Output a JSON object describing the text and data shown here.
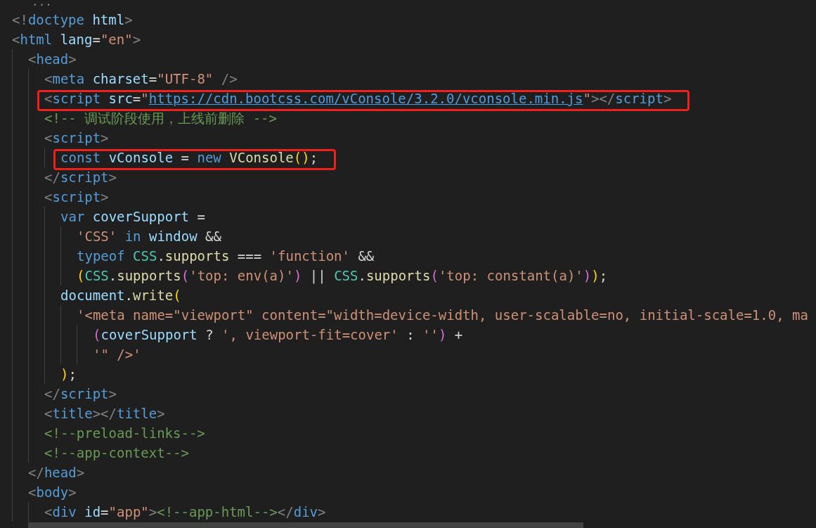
{
  "editor": {
    "fold_marker": "...",
    "lines": [
      {
        "highlighted": false,
        "tokens": [
          {
            "kind": "punct",
            "text": "<!"
          },
          {
            "kind": "tag",
            "text": "doctype"
          },
          {
            "kind": "attr",
            "text": " html"
          },
          {
            "kind": "punct",
            "text": ">"
          }
        ]
      },
      {
        "highlighted": false,
        "tokens": [
          {
            "kind": "punct",
            "text": "<"
          },
          {
            "kind": "tag",
            "text": "html"
          },
          {
            "kind": "attr",
            "text": " lang"
          },
          {
            "kind": "plain",
            "text": "="
          },
          {
            "kind": "string",
            "text": "\"en\""
          },
          {
            "kind": "punct",
            "text": ">"
          }
        ],
        "children": [
          {
            "highlighted": false,
            "tokens": [
              {
                "kind": "punct",
                "text": "<"
              },
              {
                "kind": "tag",
                "text": "head"
              },
              {
                "kind": "punct",
                "text": ">"
              }
            ],
            "children": [
              {
                "highlighted": false,
                "tokens": [
                  {
                    "kind": "punct",
                    "text": "<"
                  },
                  {
                    "kind": "tag",
                    "text": "meta"
                  },
                  {
                    "kind": "attr",
                    "text": " charset"
                  },
                  {
                    "kind": "plain",
                    "text": "="
                  },
                  {
                    "kind": "string",
                    "text": "\"UTF-8\""
                  },
                  {
                    "kind": "punct",
                    "text": " />"
                  }
                ]
              },
              {
                "highlighted": true,
                "tokens": [
                  {
                    "kind": "punct",
                    "text": "<"
                  },
                  {
                    "kind": "tag",
                    "text": "script"
                  },
                  {
                    "kind": "attr",
                    "text": " src"
                  },
                  {
                    "kind": "plain",
                    "text": "="
                  },
                  {
                    "kind": "string",
                    "text": "\""
                  },
                  {
                    "kind": "link",
                    "text": "https://cdn.bootcss.com/vConsole/3.2.0/vconsole.min.js"
                  },
                  {
                    "kind": "string",
                    "text": "\""
                  },
                  {
                    "kind": "punct",
                    "text": "></"
                  },
                  {
                    "kind": "tag",
                    "text": "script"
                  },
                  {
                    "kind": "punct",
                    "text": ">"
                  }
                ]
              },
              {
                "highlighted": false,
                "tokens": [
                  {
                    "kind": "comment",
                    "text": "<!-- 调试阶段使用，上线前删除 -->"
                  }
                ]
              },
              {
                "highlighted": false,
                "tokens": [
                  {
                    "kind": "punct",
                    "text": "<"
                  },
                  {
                    "kind": "tag",
                    "text": "script"
                  },
                  {
                    "kind": "punct",
                    "text": ">"
                  }
                ],
                "children": [
                  {
                    "highlighted": true,
                    "tokens": [
                      {
                        "kind": "keyword",
                        "text": "const"
                      },
                      {
                        "kind": "variable",
                        "text": " vConsole"
                      },
                      {
                        "kind": "plain",
                        "text": " = "
                      },
                      {
                        "kind": "keyword",
                        "text": "new"
                      },
                      {
                        "kind": "function",
                        "text": " VConsole"
                      },
                      {
                        "kind": "bracket1",
                        "text": "()"
                      },
                      {
                        "kind": "plain",
                        "text": ";"
                      }
                    ]
                  }
                ]
              },
              {
                "highlighted": false,
                "tokens": [
                  {
                    "kind": "punct",
                    "text": "</"
                  },
                  {
                    "kind": "tag",
                    "text": "script"
                  },
                  {
                    "kind": "punct",
                    "text": ">"
                  }
                ]
              },
              {
                "highlighted": false,
                "tokens": [
                  {
                    "kind": "punct",
                    "text": "<"
                  },
                  {
                    "kind": "tag",
                    "text": "script"
                  },
                  {
                    "kind": "punct",
                    "text": ">"
                  }
                ],
                "children": [
                  {
                    "highlighted": false,
                    "tokens": [
                      {
                        "kind": "keyword",
                        "text": "var"
                      },
                      {
                        "kind": "variable",
                        "text": " coverSupport"
                      },
                      {
                        "kind": "plain",
                        "text": " ="
                      }
                    ],
                    "children": [
                      {
                        "highlighted": false,
                        "tokens": [
                          {
                            "kind": "string",
                            "text": "'CSS'"
                          },
                          {
                            "kind": "keyword",
                            "text": " in"
                          },
                          {
                            "kind": "variable",
                            "text": " window"
                          },
                          {
                            "kind": "plain",
                            "text": " &&"
                          }
                        ]
                      },
                      {
                        "highlighted": false,
                        "tokens": [
                          {
                            "kind": "keyword",
                            "text": "typeof"
                          },
                          {
                            "kind": "class",
                            "text": " CSS"
                          },
                          {
                            "kind": "plain",
                            "text": "."
                          },
                          {
                            "kind": "function",
                            "text": "supports"
                          },
                          {
                            "kind": "plain",
                            "text": " === "
                          },
                          {
                            "kind": "string",
                            "text": "'function'"
                          },
                          {
                            "kind": "plain",
                            "text": " &&"
                          }
                        ]
                      },
                      {
                        "highlighted": false,
                        "tokens": [
                          {
                            "kind": "bracket1",
                            "text": "("
                          },
                          {
                            "kind": "class",
                            "text": "CSS"
                          },
                          {
                            "kind": "plain",
                            "text": "."
                          },
                          {
                            "kind": "function",
                            "text": "supports"
                          },
                          {
                            "kind": "bracket2",
                            "text": "("
                          },
                          {
                            "kind": "string",
                            "text": "'top: env(a)'"
                          },
                          {
                            "kind": "bracket2",
                            "text": ")"
                          },
                          {
                            "kind": "plain",
                            "text": " || "
                          },
                          {
                            "kind": "class",
                            "text": "CSS"
                          },
                          {
                            "kind": "plain",
                            "text": "."
                          },
                          {
                            "kind": "function",
                            "text": "supports"
                          },
                          {
                            "kind": "bracket2",
                            "text": "("
                          },
                          {
                            "kind": "string",
                            "text": "'top: constant(a)'"
                          },
                          {
                            "kind": "bracket2",
                            "text": ")"
                          },
                          {
                            "kind": "bracket1",
                            "text": ")"
                          },
                          {
                            "kind": "plain",
                            "text": ";"
                          }
                        ]
                      }
                    ]
                  },
                  {
                    "highlighted": false,
                    "tokens": [
                      {
                        "kind": "variable",
                        "text": "document"
                      },
                      {
                        "kind": "function",
                        "text": ".write"
                      },
                      {
                        "kind": "bracket1",
                        "text": "("
                      }
                    ],
                    "children": [
                      {
                        "highlighted": false,
                        "tokens": [
                          {
                            "kind": "string",
                            "text": "'<meta name=\"viewport\" content=\"width=device-width, user-scalable=no, initial-scale=1.0, ma"
                          }
                        ],
                        "children": [
                          {
                            "highlighted": false,
                            "tokens": [
                              {
                                "kind": "bracket2",
                                "text": "("
                              },
                              {
                                "kind": "variable",
                                "text": "coverSupport"
                              },
                              {
                                "kind": "plain",
                                "text": " ? "
                              },
                              {
                                "kind": "string",
                                "text": "', viewport-fit=cover'"
                              },
                              {
                                "kind": "plain",
                                "text": " : "
                              },
                              {
                                "kind": "string",
                                "text": "''"
                              },
                              {
                                "kind": "bracket2",
                                "text": ")"
                              },
                              {
                                "kind": "plain",
                                "text": " +"
                              }
                            ]
                          },
                          {
                            "highlighted": false,
                            "tokens": [
                              {
                                "kind": "string",
                                "text": "'\" />'"
                              }
                            ]
                          }
                        ]
                      }
                    ]
                  },
                  {
                    "highlighted": false,
                    "tokens": [
                      {
                        "kind": "bracket1",
                        "text": ")"
                      },
                      {
                        "kind": "plain",
                        "text": ";"
                      }
                    ]
                  }
                ]
              },
              {
                "highlighted": false,
                "tokens": [
                  {
                    "kind": "punct",
                    "text": "</"
                  },
                  {
                    "kind": "tag",
                    "text": "script"
                  },
                  {
                    "kind": "punct",
                    "text": ">"
                  }
                ]
              },
              {
                "highlighted": false,
                "tokens": [
                  {
                    "kind": "punct",
                    "text": "<"
                  },
                  {
                    "kind": "tag",
                    "text": "title"
                  },
                  {
                    "kind": "punct",
                    "text": "></"
                  },
                  {
                    "kind": "tag",
                    "text": "title"
                  },
                  {
                    "kind": "punct",
                    "text": ">"
                  }
                ]
              },
              {
                "highlighted": false,
                "tokens": [
                  {
                    "kind": "comment",
                    "text": "<!--preload-links-->"
                  }
                ]
              },
              {
                "highlighted": false,
                "tokens": [
                  {
                    "kind": "comment",
                    "text": "<!--app-context-->"
                  }
                ]
              }
            ]
          },
          {
            "highlighted": false,
            "tokens": [
              {
                "kind": "punct",
                "text": "</"
              },
              {
                "kind": "tag",
                "text": "head"
              },
              {
                "kind": "punct",
                "text": ">"
              }
            ]
          },
          {
            "highlighted": false,
            "tokens": [
              {
                "kind": "punct",
                "text": "<"
              },
              {
                "kind": "tag",
                "text": "body"
              },
              {
                "kind": "punct",
                "text": ">"
              }
            ],
            "children": [
              {
                "highlighted": false,
                "tokens": [
                  {
                    "kind": "punct",
                    "text": "<"
                  },
                  {
                    "kind": "tag",
                    "text": "div"
                  },
                  {
                    "kind": "attr",
                    "text": " id"
                  },
                  {
                    "kind": "plain",
                    "text": "="
                  },
                  {
                    "kind": "string",
                    "text": "\"app\""
                  },
                  {
                    "kind": "punct",
                    "text": ">"
                  },
                  {
                    "kind": "comment",
                    "text": "<!--app-html-->"
                  },
                  {
                    "kind": "punct",
                    "text": "</"
                  },
                  {
                    "kind": "tag",
                    "text": "div"
                  },
                  {
                    "kind": "punct",
                    "text": ">"
                  }
                ]
              }
            ]
          }
        ]
      }
    ]
  }
}
